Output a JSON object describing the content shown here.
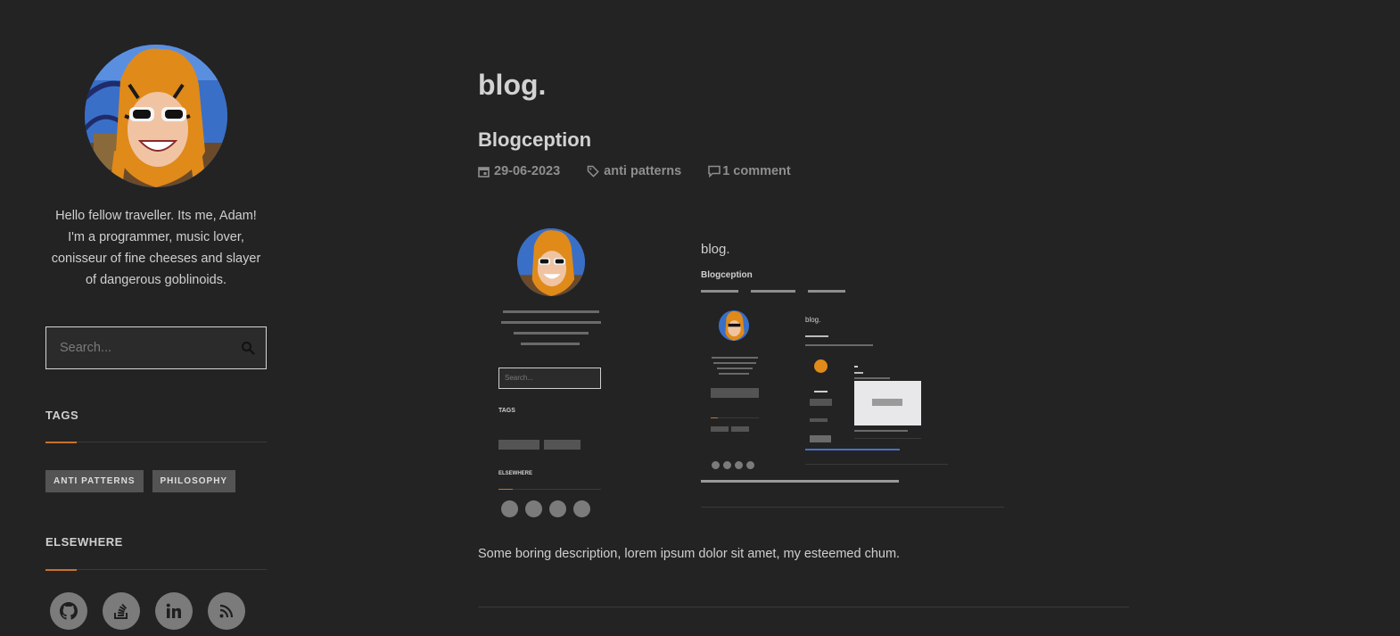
{
  "sidebar": {
    "bio": "Hello fellow traveller. Its me, Adam! I'm a programmer, music lover, conisseur of fine cheeses and slayer of dangerous goblinoids.",
    "search": {
      "placeholder": "Search..."
    },
    "tags_title": "TAGS",
    "tags": [
      "ANTI PATTERNS",
      "PHILOSOPHY"
    ],
    "elsewhere_title": "ELSEWHERE",
    "socials": [
      "github-icon",
      "stackoverflow-icon",
      "linkedin-icon",
      "rss-icon"
    ]
  },
  "main": {
    "blog_title": "blog.",
    "post": {
      "title": "Blogception",
      "date": "29-06-2023",
      "tag": "anti patterns",
      "comments": "1 comment",
      "description": "Some boring description, lorem ipsum dolor sit amet, my esteemed chum."
    }
  },
  "embedded_screenshot": {
    "blog_title": "blog.",
    "post_title": "Blogception",
    "tags_title": "TAGS",
    "elsewhere_title": "ELSEWHERE",
    "search_placeholder": "Search...",
    "nested_blog_title": "blog."
  },
  "colors": {
    "background": "#232323",
    "accent": "#c7732b",
    "tag_bg": "#545454",
    "social_bg": "#7b7b7b",
    "meta": "#8e8e8e"
  }
}
